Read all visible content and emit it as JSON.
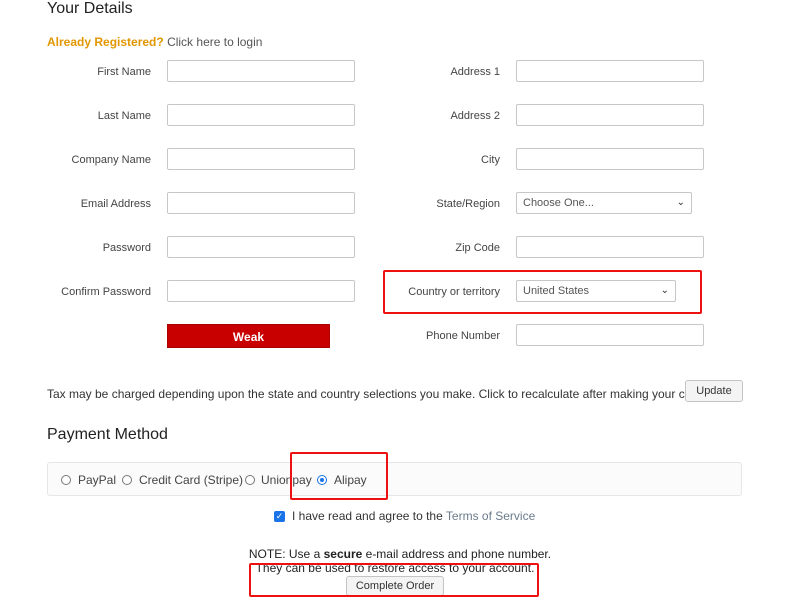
{
  "section_details": "Your Details",
  "login": {
    "already": "Already Registered?",
    "click": "Click here to login"
  },
  "left_fields": [
    {
      "label": "First Name",
      "value": ""
    },
    {
      "label": "Last Name",
      "value": ""
    },
    {
      "label": "Company Name",
      "value": ""
    },
    {
      "label": "Email Address",
      "value": ""
    },
    {
      "label": "Password",
      "value": ""
    },
    {
      "label": "Confirm Password",
      "value": ""
    }
  ],
  "right_fields": {
    "address1": {
      "label": "Address 1",
      "value": ""
    },
    "address2": {
      "label": "Address 2",
      "value": ""
    },
    "city": {
      "label": "City",
      "value": ""
    },
    "state": {
      "label": "State/Region",
      "selected": "Choose One..."
    },
    "zip": {
      "label": "Zip Code",
      "value": ""
    },
    "country": {
      "label": "Country or territory",
      "selected": "United States"
    },
    "phone": {
      "label": "Phone Number",
      "value": ""
    }
  },
  "password_strength": "Weak",
  "tax_note": "Tax may be charged depending upon the state and country selections you make. Click to recalculate after making your choices.",
  "update_button": "Update",
  "section_payment": "Payment Method",
  "payment_options": [
    {
      "label": "PayPal",
      "selected": false
    },
    {
      "label": "Credit Card (Stripe)",
      "selected": false
    },
    {
      "label": "Unionpay",
      "selected": false
    },
    {
      "label": "Alipay",
      "selected": true
    }
  ],
  "tos": {
    "prefix": "I have read and agree to the",
    "link": "Terms of Service",
    "checked": true
  },
  "note": {
    "prefix": "NOTE: Use a",
    "bold": "secure",
    "suffix": "e-mail address and phone number.",
    "line2": "They can be used to restore access to your account."
  },
  "complete_button": "Complete Order",
  "colors": {
    "weak_bg": "#c90000",
    "highlight": "#e11111",
    "accent": "#e29700",
    "link": "#6b7c8c"
  }
}
